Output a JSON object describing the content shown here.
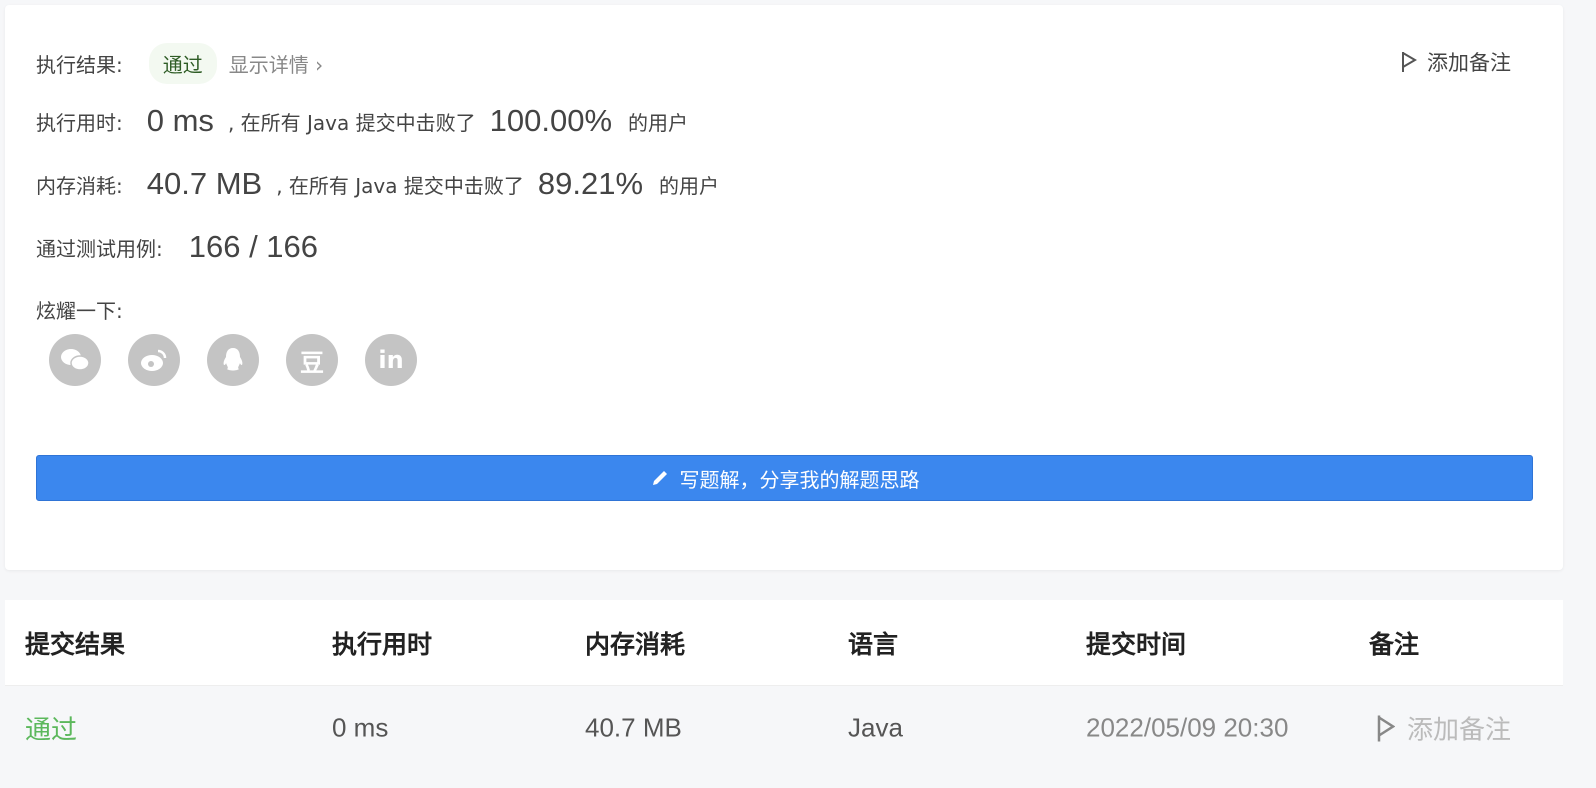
{
  "result": {
    "label": "执行结果:",
    "status": "通过",
    "details_link": "显示详情 ›",
    "add_note": "添加备注"
  },
  "runtime": {
    "label": "执行用时:",
    "value": "0 ms",
    "mid": ", 在所有 Java 提交中击败了",
    "percent": "100.00%",
    "suffix": "的用户"
  },
  "memory": {
    "label": "内存消耗:",
    "value": "40.7 MB",
    "mid": ", 在所有 Java 提交中击败了",
    "percent": "89.21%",
    "suffix": "的用户"
  },
  "tests": {
    "label": "通过测试用例:",
    "value": "166 / 166"
  },
  "share": {
    "label": "炫耀一下:",
    "icons": [
      "wechat-icon",
      "weibo-icon",
      "qq-icon",
      "douban-icon",
      "linkedin-icon"
    ],
    "douban_glyph": "豆",
    "linkedin_glyph": "in"
  },
  "write_solution": "写题解，分享我的解题思路",
  "colors": {
    "accent": "#3b87ee",
    "pass": "#5cb85c"
  },
  "table": {
    "headers": [
      "提交结果",
      "执行用时",
      "内存消耗",
      "语言",
      "提交时间",
      "备注"
    ],
    "rows": [
      {
        "result": "通过",
        "runtime": "0 ms",
        "memory": "40.7 MB",
        "language": "Java",
        "time": "2022/05/09 20:30",
        "note": "添加备注"
      }
    ]
  }
}
